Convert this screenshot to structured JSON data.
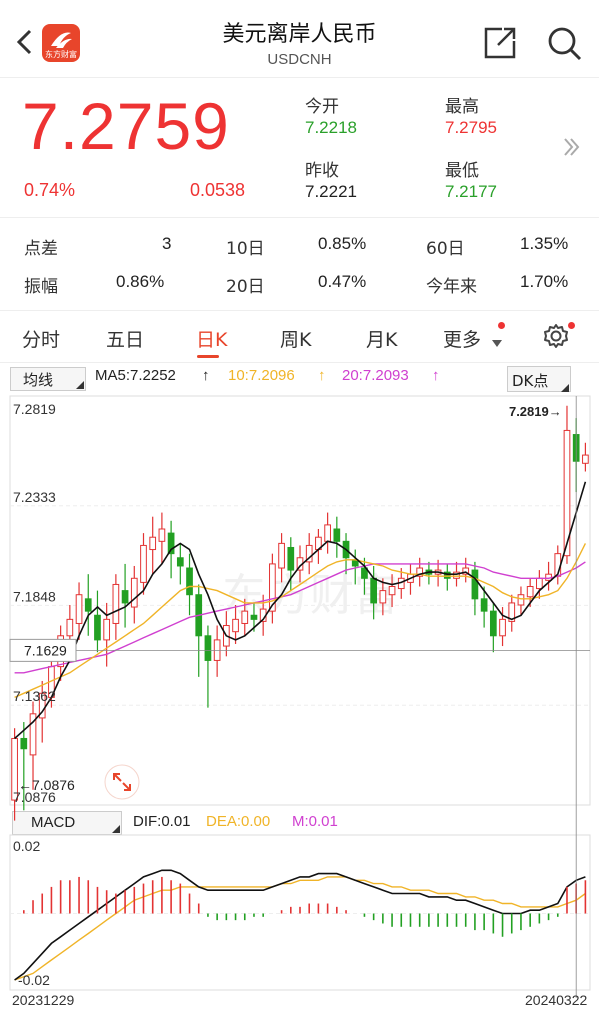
{
  "header": {
    "title": "美元离岸人民币",
    "subtitle": "USDCNH",
    "logo_text": "东方财富"
  },
  "quote": {
    "price": "7.2759",
    "change_pct": "0.74%",
    "change": "0.0538",
    "open_label": "今开",
    "open": "7.2218",
    "high_label": "最高",
    "high": "7.2795",
    "prev_close_label": "昨收",
    "prev_close": "7.2221",
    "low_label": "最低",
    "low": "7.2177"
  },
  "stats": {
    "spread_label": "点差",
    "spread": "3",
    "d10_label": "10日",
    "d10": "0.85%",
    "d60_label": "60日",
    "d60": "1.35%",
    "amp_label": "振幅",
    "amp": "0.86%",
    "d20_label": "20日",
    "d20": "0.47%",
    "ytd_label": "今年来",
    "ytd": "1.70%"
  },
  "tabs": [
    "分时",
    "五日",
    "日K",
    "周K",
    "月K",
    "更多"
  ],
  "chart_head": {
    "ma_select": "均线",
    "ma5": "MA5:7.2252",
    "ma10": "10:7.2096",
    "ma20": "20:7.2093",
    "dk": "DK点"
  },
  "macd_head": {
    "select": "MACD",
    "dif": "DIF:0.01",
    "dea": "DEA:0.00",
    "m": "M:0.01"
  },
  "chart_data": {
    "type": "candlestick",
    "price_axis_labels": [
      "7.2819",
      "7.2333",
      "7.1848",
      "7.1362",
      "7.0876"
    ],
    "crosshair_price": "7.1629",
    "max_marker": "7.2819",
    "min_marker": "7.0876",
    "macd_axis_labels": [
      "0.02",
      "-0.02"
    ],
    "date_start": "20231229",
    "date_end": "20240322",
    "watermark": "东方财富",
    "colors": {
      "up": "#e33333",
      "down": "#22a022",
      "ma5": "#111111",
      "ma10": "#f0b428",
      "ma20": "#d040d0"
    },
    "candles": [
      [
        7.09,
        7.12,
        7.08,
        7.125
      ],
      [
        7.12,
        7.115,
        7.085,
        7.128
      ],
      [
        7.112,
        7.132,
        7.095,
        7.138
      ],
      [
        7.13,
        7.142,
        7.118,
        7.148
      ],
      [
        7.14,
        7.155,
        7.135,
        7.16
      ],
      [
        7.155,
        7.17,
        7.148,
        7.175
      ],
      [
        7.17,
        7.178,
        7.16,
        7.185
      ],
      [
        7.176,
        7.19,
        7.168,
        7.196
      ],
      [
        7.188,
        7.182,
        7.17,
        7.2
      ],
      [
        7.18,
        7.168,
        7.162,
        7.192
      ],
      [
        7.168,
        7.178,
        7.155,
        7.186
      ],
      [
        7.176,
        7.195,
        7.168,
        7.2
      ],
      [
        7.192,
        7.186,
        7.174,
        7.205
      ],
      [
        7.184,
        7.198,
        7.176,
        7.204
      ],
      [
        7.196,
        7.214,
        7.19,
        7.22
      ],
      [
        7.212,
        7.218,
        7.2,
        7.228
      ],
      [
        7.216,
        7.222,
        7.205,
        7.23
      ],
      [
        7.22,
        7.21,
        7.198,
        7.226
      ],
      [
        7.208,
        7.204,
        7.195,
        7.215
      ],
      [
        7.203,
        7.19,
        7.18,
        7.21
      ],
      [
        7.19,
        7.17,
        7.15,
        7.195
      ],
      [
        7.17,
        7.158,
        7.135,
        7.175
      ],
      [
        7.158,
        7.168,
        7.15,
        7.175
      ],
      [
        7.165,
        7.175,
        7.16,
        7.182
      ],
      [
        7.172,
        7.178,
        7.166,
        7.185
      ],
      [
        7.176,
        7.182,
        7.17,
        7.188
      ],
      [
        7.18,
        7.178,
        7.172,
        7.186
      ],
      [
        7.177,
        7.183,
        7.17,
        7.19
      ],
      [
        7.182,
        7.205,
        7.176,
        7.21
      ],
      [
        7.203,
        7.215,
        7.196,
        7.22
      ],
      [
        7.213,
        7.202,
        7.192,
        7.218
      ],
      [
        7.202,
        7.208,
        7.196,
        7.214
      ],
      [
        7.206,
        7.214,
        7.2,
        7.22
      ],
      [
        7.212,
        7.218,
        7.205,
        7.222
      ],
      [
        7.216,
        7.224,
        7.21,
        7.23
      ],
      [
        7.222,
        7.216,
        7.208,
        7.228
      ],
      [
        7.216,
        7.208,
        7.2,
        7.22
      ],
      [
        7.207,
        7.204,
        7.195,
        7.212
      ],
      [
        7.203,
        7.198,
        7.19,
        7.208
      ],
      [
        7.198,
        7.186,
        7.178,
        7.204
      ],
      [
        7.186,
        7.192,
        7.18,
        7.198
      ],
      [
        7.19,
        7.194,
        7.184,
        7.2
      ],
      [
        7.193,
        7.198,
        7.188,
        7.203
      ],
      [
        7.196,
        7.2,
        7.19,
        7.205
      ],
      [
        7.199,
        7.203,
        7.194,
        7.208
      ],
      [
        7.202,
        7.2,
        7.195,
        7.206
      ],
      [
        7.2,
        7.202,
        7.194,
        7.207
      ],
      [
        7.201,
        7.198,
        7.192,
        7.205
      ],
      [
        7.198,
        7.201,
        7.194,
        7.206
      ],
      [
        7.2,
        7.203,
        7.196,
        7.208
      ],
      [
        7.202,
        7.188,
        7.18,
        7.206
      ],
      [
        7.188,
        7.182,
        7.174,
        7.194
      ],
      [
        7.182,
        7.17,
        7.162,
        7.186
      ],
      [
        7.17,
        7.178,
        7.165,
        7.184
      ],
      [
        7.177,
        7.186,
        7.172,
        7.19
      ],
      [
        7.185,
        7.19,
        7.18,
        7.194
      ],
      [
        7.189,
        7.194,
        7.184,
        7.198
      ],
      [
        7.193,
        7.198,
        7.188,
        7.202
      ],
      [
        7.197,
        7.2,
        7.192,
        7.206
      ],
      [
        7.199,
        7.21,
        7.195,
        7.214
      ],
      [
        7.209,
        7.27,
        7.205,
        7.282
      ],
      [
        7.268,
        7.255,
        7.24,
        7.276
      ],
      [
        7.254,
        7.258,
        7.25,
        7.264
      ]
    ],
    "ma5": [
      7.12,
      7.124,
      7.128,
      7.133,
      7.14,
      7.15,
      7.158,
      7.17,
      7.18,
      7.184,
      7.18,
      7.182,
      7.184,
      7.188,
      7.192,
      7.2,
      7.205,
      7.212,
      7.215,
      7.212,
      7.2,
      7.19,
      7.178,
      7.17,
      7.168,
      7.17,
      7.174,
      7.178,
      7.185,
      7.19,
      7.198,
      7.204,
      7.208,
      7.212,
      7.216,
      7.215,
      7.212,
      7.208,
      7.204,
      7.198,
      7.196,
      7.195,
      7.196,
      7.198,
      7.2,
      7.201,
      7.201,
      7.2,
      7.2,
      7.201,
      7.198,
      7.192,
      7.186,
      7.18,
      7.178,
      7.18,
      7.186,
      7.192,
      7.196,
      7.2,
      7.215,
      7.23,
      7.245
    ],
    "ma10": [
      7.14,
      7.142,
      7.144,
      7.146,
      7.148,
      7.15,
      7.152,
      7.155,
      7.158,
      7.161,
      7.164,
      7.167,
      7.17,
      7.173,
      7.176,
      7.18,
      7.184,
      7.188,
      7.192,
      7.194,
      7.194,
      7.193,
      7.192,
      7.19,
      7.188,
      7.186,
      7.186,
      7.186,
      7.187,
      7.189,
      7.192,
      7.195,
      7.198,
      7.201,
      7.204,
      7.206,
      7.207,
      7.207,
      7.206,
      7.205,
      7.204,
      7.202,
      7.201,
      7.2,
      7.2,
      7.199,
      7.199,
      7.199,
      7.199,
      7.199,
      7.198,
      7.196,
      7.194,
      7.191,
      7.189,
      7.188,
      7.188,
      7.189,
      7.19,
      7.192,
      7.198,
      7.206,
      7.215
    ],
    "ma20": [
      7.152,
      7.152,
      7.153,
      7.154,
      7.155,
      7.156,
      7.157,
      7.158,
      7.159,
      7.16,
      7.161,
      7.163,
      7.165,
      7.167,
      7.169,
      7.171,
      7.173,
      7.175,
      7.177,
      7.179,
      7.18,
      7.181,
      7.182,
      7.183,
      7.184,
      7.185,
      7.186,
      7.187,
      7.188,
      7.189,
      7.19,
      7.192,
      7.194,
      7.196,
      7.198,
      7.2,
      7.202,
      7.203,
      7.204,
      7.205,
      7.205,
      7.205,
      7.205,
      7.205,
      7.205,
      7.205,
      7.205,
      7.205,
      7.205,
      7.205,
      7.204,
      7.203,
      7.201,
      7.2,
      7.199,
      7.198,
      7.198,
      7.198,
      7.198,
      7.199,
      7.201,
      7.203,
      7.206
    ],
    "macd_bars": [
      0.0,
      0.001,
      0.004,
      0.006,
      0.008,
      0.01,
      0.01,
      0.011,
      0.01,
      0.008,
      0.007,
      0.006,
      0.007,
      0.008,
      0.009,
      0.01,
      0.011,
      0.01,
      0.009,
      0.006,
      0.003,
      -0.001,
      -0.002,
      -0.002,
      -0.002,
      -0.002,
      -0.001,
      -0.001,
      0.0,
      0.001,
      0.002,
      0.002,
      0.003,
      0.003,
      0.003,
      0.002,
      0.001,
      0.0,
      -0.001,
      -0.002,
      -0.003,
      -0.004,
      -0.004,
      -0.004,
      -0.004,
      -0.004,
      -0.004,
      -0.004,
      -0.004,
      -0.004,
      -0.005,
      -0.005,
      -0.006,
      -0.007,
      -0.006,
      -0.005,
      -0.004,
      -0.003,
      -0.002,
      -0.001,
      0.008,
      0.009,
      0.01
    ],
    "dif": [
      -0.02,
      -0.018,
      -0.015,
      -0.012,
      -0.009,
      -0.007,
      -0.005,
      -0.003,
      -0.001,
      0.001,
      0.003,
      0.005,
      0.007,
      0.009,
      0.011,
      0.012,
      0.013,
      0.013,
      0.012,
      0.01,
      0.008,
      0.007,
      0.007,
      0.007,
      0.007,
      0.007,
      0.007,
      0.007,
      0.008,
      0.009,
      0.01,
      0.011,
      0.011,
      0.012,
      0.012,
      0.012,
      0.011,
      0.01,
      0.009,
      0.008,
      0.007,
      0.006,
      0.006,
      0.006,
      0.006,
      0.005,
      0.005,
      0.005,
      0.004,
      0.004,
      0.003,
      0.002,
      0.001,
      0.0,
      0.0,
      0.0,
      0.001,
      0.001,
      0.002,
      0.003,
      0.008,
      0.01,
      0.011
    ],
    "dea": [
      -0.02,
      -0.019,
      -0.018,
      -0.016,
      -0.014,
      -0.012,
      -0.01,
      -0.008,
      -0.006,
      -0.004,
      -0.002,
      0.0,
      0.002,
      0.004,
      0.005,
      0.006,
      0.007,
      0.007,
      0.008,
      0.008,
      0.008,
      0.008,
      0.008,
      0.008,
      0.008,
      0.008,
      0.008,
      0.008,
      0.008,
      0.009,
      0.009,
      0.01,
      0.01,
      0.01,
      0.011,
      0.011,
      0.011,
      0.01,
      0.01,
      0.009,
      0.009,
      0.008,
      0.008,
      0.007,
      0.007,
      0.007,
      0.006,
      0.006,
      0.006,
      0.005,
      0.005,
      0.004,
      0.004,
      0.003,
      0.003,
      0.002,
      0.002,
      0.002,
      0.002,
      0.002,
      0.003,
      0.004,
      0.006
    ]
  }
}
